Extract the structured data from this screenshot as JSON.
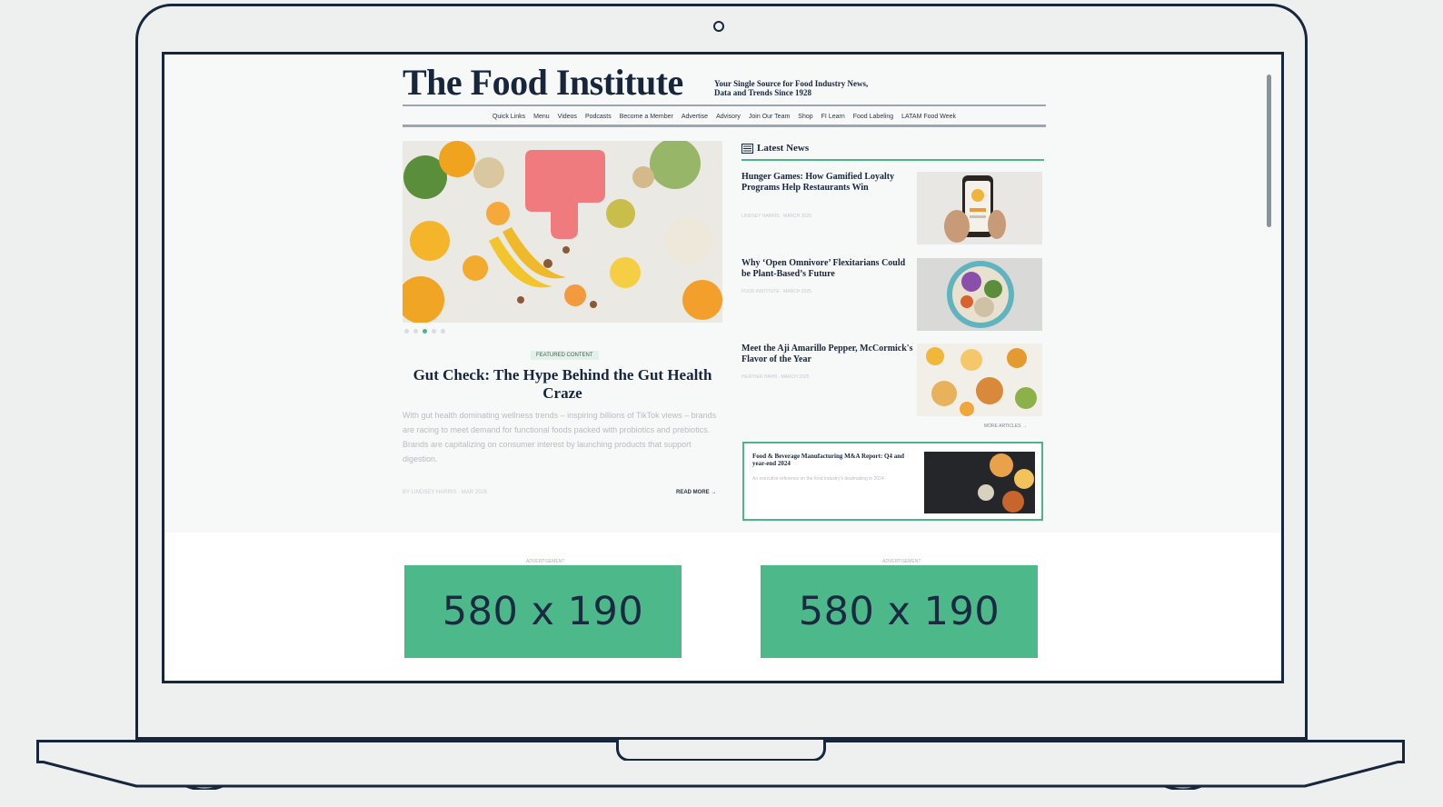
{
  "site": {
    "logo": "The Food Institute",
    "tagline": "Your Single Source for Food Industry News, Data and Trends Since 1928",
    "nav": [
      "Quick Links",
      "Menu",
      "Videos",
      "Podcasts",
      "Become a Member",
      "Advertise",
      "Advisory",
      "Join Our Team",
      "Shop",
      "FI Learn",
      "Food Labeling",
      "LATAM Food Week"
    ]
  },
  "hero": {
    "badge": "FEATURED CONTENT",
    "title": "Gut Check: The Hype Behind the Gut Health Craze",
    "excerpt": "With gut health dominating wellness trends – inspiring billions of TikTok views – brands are racing to meet demand for functional foods packed with probiotics and prebiotics. Brands are capitalizing on consumer interest by launching products that support digestion.",
    "meta": "BY LINDSEY HARRIS · MAR 2025",
    "read_more": "READ MORE →",
    "slides": 5,
    "active_slide": 3
  },
  "latest_news": {
    "heading": "Latest News",
    "items": [
      {
        "title": "Hunger Games: How Gamified Loyalty Programs Help Restaurants Win",
        "meta": "LINDSEY HARRIS · MARCH 2025",
        "thumb": "phone-app-icon"
      },
      {
        "title": "Why ‘Open Omnivore’ Flexitarians Could be Plant-Based’s Future",
        "meta": "FOOD INSTITUTE · MARCH 2025",
        "thumb": "salad-bowl-icon"
      },
      {
        "title": "Meet the Aji Amarillo Pepper, McCormick's Flavor of the Year",
        "meta": "HEATHER HAHN · MARCH 2025",
        "thumb": "food-spread-icon"
      }
    ],
    "more": "MORE ARTICLES →"
  },
  "promo": {
    "title": "Food & Beverage Manufacturing M&A Report: Q4 and year-end 2024",
    "subtitle": "An executive reference on the food industry’s dealmaking in 2024"
  },
  "ads": [
    {
      "label": "ADVERTISEMENT",
      "text": "580 x 190"
    },
    {
      "label": "ADVERTISEMENT",
      "text": "580 x 190"
    }
  ],
  "colors": {
    "accent": "#4fb489",
    "navy": "#17263c",
    "ad": "#4db88a"
  }
}
